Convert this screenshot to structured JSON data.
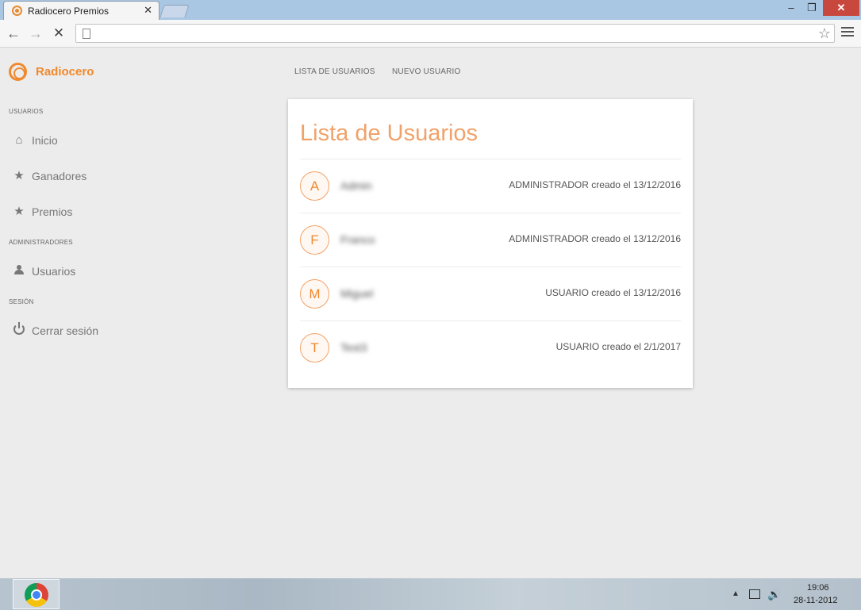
{
  "browser": {
    "tab_title": "Radiocero Premios",
    "tab_close": "✕",
    "star": "☆"
  },
  "window": {
    "min": "–",
    "max": "❐",
    "close": "✕"
  },
  "app": {
    "brand": "Radiocero"
  },
  "topnav": [
    "LISTA DE USUARIOS",
    "NUEVO USUARIO"
  ],
  "sidebar": {
    "sections": {
      "usuarios": "USUARIOS",
      "administradores": "ADMINISTRADORES",
      "sesion": "SESIÓN"
    },
    "items": [
      {
        "label": "Inicio",
        "icon": "home-icon"
      },
      {
        "label": "Ganadores",
        "icon": "star-icon"
      },
      {
        "label": "Premios",
        "icon": "star-icon"
      },
      {
        "label": "Usuarios",
        "icon": "person-icon"
      },
      {
        "label": "Cerrar sesión",
        "icon": "power-icon"
      }
    ]
  },
  "main": {
    "title": "Lista de Usuarios",
    "users": [
      {
        "initial": "A",
        "name": "Admin",
        "meta": "ADMINISTRADOR creado el 13/12/2016"
      },
      {
        "initial": "F",
        "name": "Franco",
        "meta": "ADMINISTRADOR creado el 13/12/2016"
      },
      {
        "initial": "M",
        "name": "Miguel",
        "meta": "USUARIO creado el 13/12/2016"
      },
      {
        "initial": "T",
        "name": "Test3",
        "meta": "USUARIO creado el 2/1/2017"
      }
    ]
  },
  "taskbar": {
    "time": "19:06",
    "date": "28-11-2012"
  },
  "colors": {
    "accent": "#f0892d"
  }
}
